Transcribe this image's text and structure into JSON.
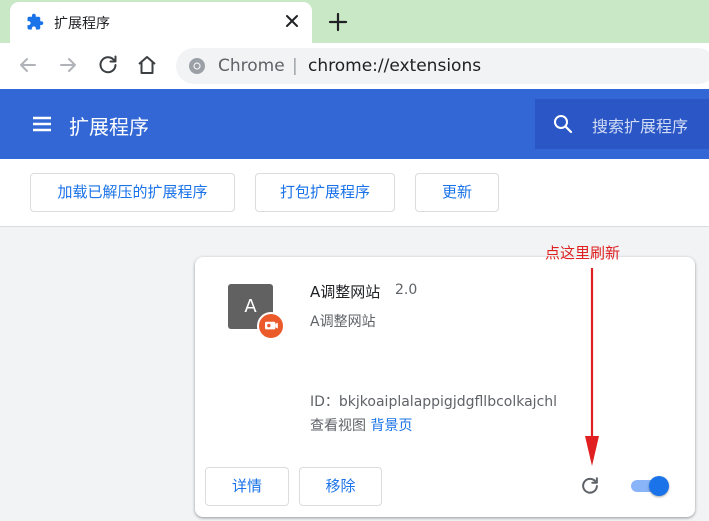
{
  "tab": {
    "title": "扩展程序",
    "icon": "puzzle-icon"
  },
  "toolbar": {
    "omnibox_host": "Chrome",
    "omnibox_separator": "|",
    "omnibox_url": "chrome://extensions"
  },
  "header": {
    "title": "扩展程序",
    "search_placeholder": "搜索扩展程序"
  },
  "dev_toolbar": {
    "load_unpacked": "加载已解压的扩展程序",
    "pack": "打包扩展程序",
    "update": "更新"
  },
  "extension": {
    "icon_letter": "A",
    "name": "A调整网站",
    "version": "2.0",
    "description": "A调整网站",
    "id_label": "ID：",
    "id_value": "bkjkoaiplalappigjdgfllbcolkajchl",
    "inspect_label": "查看视图",
    "background_link": "背景页",
    "details_button": "详情",
    "remove_button": "移除",
    "enabled": true
  },
  "annotation": {
    "text": "点这里刷新",
    "color": "#e02020"
  },
  "colors": {
    "header_blue": "#3367d6",
    "accent": "#1a73e8",
    "tabstrip": "#c9e8c6"
  }
}
